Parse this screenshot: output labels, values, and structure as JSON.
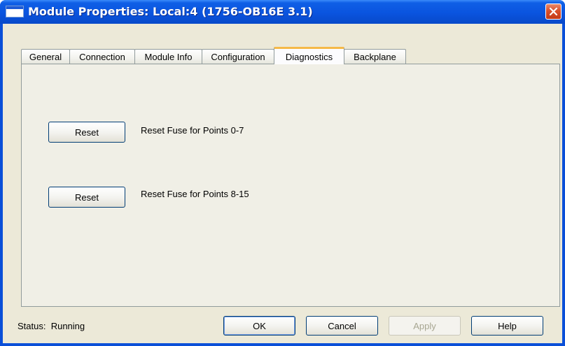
{
  "window": {
    "title": "Module Properties: Local:4 (1756-OB16E 3.1)",
    "titlebar_color": "#0a54df",
    "close_icon": "close-x-icon"
  },
  "tabs": [
    {
      "label": "General"
    },
    {
      "label": "Connection"
    },
    {
      "label": "Module Info"
    },
    {
      "label": "Configuration"
    },
    {
      "label": "Diagnostics",
      "active": true
    },
    {
      "label": "Backplane"
    }
  ],
  "diagnostics": {
    "reset_rows": [
      {
        "button_label": "Reset",
        "description": "Reset Fuse for Points 0-7"
      },
      {
        "button_label": "Reset",
        "description": "Reset Fuse for Points 8-15"
      }
    ]
  },
  "footer": {
    "status_label": "Status:",
    "status_value": "Running",
    "ok_label": "OK",
    "cancel_label": "Cancel",
    "apply_label": "Apply",
    "apply_enabled": false,
    "help_label": "Help"
  }
}
